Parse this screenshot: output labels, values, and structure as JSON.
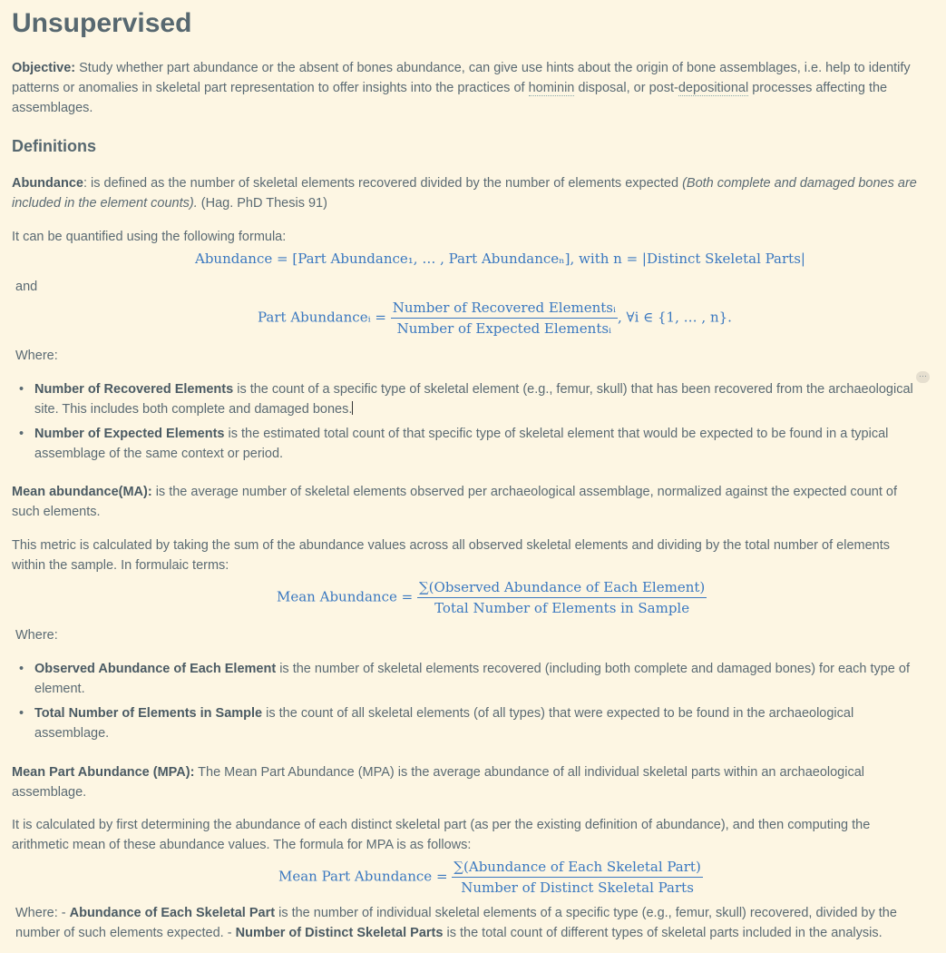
{
  "title": "Unsupervised",
  "objective": {
    "label": "Objective:",
    "text_a": " Study whether part abundance or the absent of bones abundance, can give use hints about the origin of bone assemblages, i.e. help to identify patterns or anomalies in skeletal part representation to offer insights into the practices of ",
    "link1": "hominin",
    "text_b": " disposal, or post-",
    "link2": "depositional",
    "text_c": " processes affecting the assemblages."
  },
  "definitions_heading": "Definitions",
  "abundance": {
    "label": "Abundance",
    "text": ": is defined as the number of skeletal elements recovered divided by the number of elements expected ",
    "italic": "(Both complete and damaged bones are included in the element counts).",
    "ref": " (Hag. PhD Thesis 91)",
    "formula_intro": "It can be quantified using the following formula:",
    "formula1": "Abundance = [Part Abundance₁, … , Part Abundanceₙ], with n = |Distinct Skeletal Parts|",
    "and": "and",
    "formula2_lhs": "Part Abundanceᵢ =",
    "formula2_num": "Number of Recovered Elementsᵢ",
    "formula2_den": "Number of Expected Elementsᵢ",
    "formula2_rhs": ", ∀i ∈ {1, … , n}.",
    "where": "Where:",
    "bullets": [
      {
        "term": "Number of Recovered Elements",
        "text": " is the count of a specific type of skeletal element (e.g., femur, skull) that has been recovered from the archaeological site. This includes both complete and damaged bones."
      },
      {
        "term": "Number of Expected Elements",
        "text": " is the estimated total count of that specific type of skeletal element that would be expected to be found in a typical assemblage of the same context or period."
      }
    ]
  },
  "mean_abundance": {
    "label": "Mean abundance(MA):",
    "text": " is the average number of skeletal elements observed per archaeological assemblage, normalized against the expected count of such elements.",
    "calc": "This metric is calculated by taking the sum of the abundance values across all observed skeletal elements and dividing by the total number of elements within the sample. In formulaic terms:",
    "formula_lhs": "Mean Abundance =",
    "formula_num": "∑(Observed Abundance of Each Element)",
    "formula_den": "Total Number of Elements in Sample",
    "where": "Where:",
    "bullets": [
      {
        "term": "Observed Abundance of Each Element",
        "text": " is the number of skeletal elements recovered (including both complete and damaged bones) for each type of element."
      },
      {
        "term": "Total Number of Elements in Sample",
        "text": " is the count of all skeletal elements (of all types) that were expected to be found in the archaeological assemblage."
      }
    ]
  },
  "mpa": {
    "label": "Mean Part Abundance (MPA):",
    "text": " The Mean Part Abundance (MPA) is the average abundance of all individual skeletal parts within an archaeological assemblage.",
    "calc": "It is calculated by first determining the abundance of each distinct skeletal part (as per the existing definition of abundance), and then computing the arithmetic mean of these abundance values. The formula for MPA is as follows:",
    "formula_lhs": "Mean Part Abundance =",
    "formula_num": "∑(Abundance of Each Skeletal Part)",
    "formula_den": "Number of Distinct Skeletal Parts",
    "where_prefix": "Where: - ",
    "term1": "Abundance of Each Skeletal Part",
    "text1": " is the number of individual skeletal elements of a specific type (e.g., femur, skull) recovered, divided by the number of such elements expected. - ",
    "term2": "Number of Distinct Skeletal Parts",
    "text2": " is the total count of different types of skeletal parts included in the analysis."
  },
  "more_button": "···"
}
